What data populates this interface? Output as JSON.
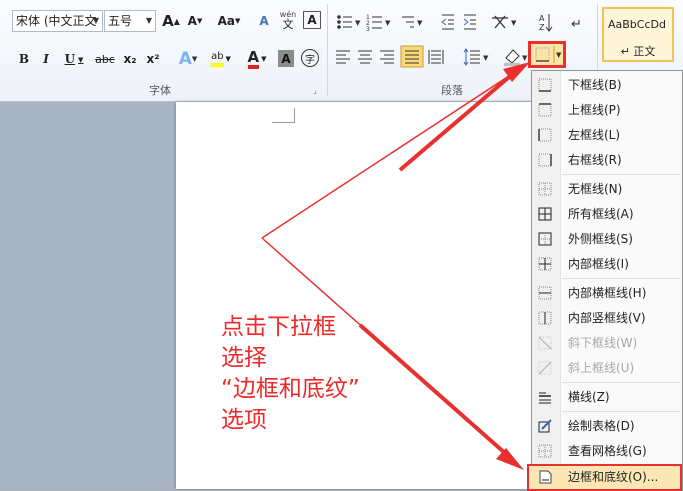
{
  "ribbon": {
    "font_name": "宋体 (中文正文",
    "font_size": "五号",
    "group_font_label": "字体",
    "group_paragraph_label": "段落",
    "grow_font": "A",
    "shrink_font": "A",
    "change_case": "Aa",
    "bold": "B",
    "italic": "I",
    "underline": "U",
    "strike": "abc",
    "subscript": "x₂",
    "superscript": "x²",
    "text_effect": "A",
    "highlight": "ab",
    "font_color": "A",
    "char_shading": "A",
    "enclose": "字",
    "clear_format": "A",
    "phonetic": "wén",
    "phonetic_char": "文",
    "border_char": "A",
    "style_preview": "AaBbCcDd",
    "style_name": "↵ 正文"
  },
  "annotation": {
    "text": "点击下拉框\n选择\n“边框和底纹”\n选项",
    "color": "#ee2a2a"
  },
  "menu": {
    "items": [
      {
        "label": "下框线(B)",
        "icon": "bottom-border-icon",
        "disabled": false
      },
      {
        "label": "上框线(P)",
        "icon": "top-border-icon",
        "disabled": false
      },
      {
        "label": "左框线(L)",
        "icon": "left-border-icon",
        "disabled": false
      },
      {
        "label": "右框线(R)",
        "icon": "right-border-icon",
        "disabled": false
      },
      {
        "label": "无框线(N)",
        "icon": "no-border-icon",
        "disabled": false
      },
      {
        "label": "所有框线(A)",
        "icon": "all-borders-icon",
        "disabled": false
      },
      {
        "label": "外侧框线(S)",
        "icon": "outside-borders-icon",
        "disabled": false
      },
      {
        "label": "内部框线(I)",
        "icon": "inside-borders-icon",
        "disabled": false
      },
      {
        "label": "内部横框线(H)",
        "icon": "inside-horizontal-border-icon",
        "disabled": false
      },
      {
        "label": "内部竖框线(V)",
        "icon": "inside-vertical-border-icon",
        "disabled": false
      },
      {
        "label": "斜下框线(W)",
        "icon": "diagonal-down-border-icon",
        "disabled": true
      },
      {
        "label": "斜上框线(U)",
        "icon": "diagonal-up-border-icon",
        "disabled": true
      },
      {
        "label": "横线(Z)",
        "icon": "horizontal-line-icon",
        "disabled": false
      },
      {
        "label": "绘制表格(D)",
        "icon": "draw-table-icon",
        "disabled": false
      },
      {
        "label": "查看网格线(G)",
        "icon": "view-gridlines-icon",
        "disabled": false
      },
      {
        "label": "边框和底纹(O)...",
        "icon": "borders-shading-icon",
        "disabled": false
      }
    ]
  },
  "colors": {
    "highlight_box": "#e8312f",
    "arrow": "#e8312f",
    "selected_item_bg": "#fbe7b3"
  }
}
